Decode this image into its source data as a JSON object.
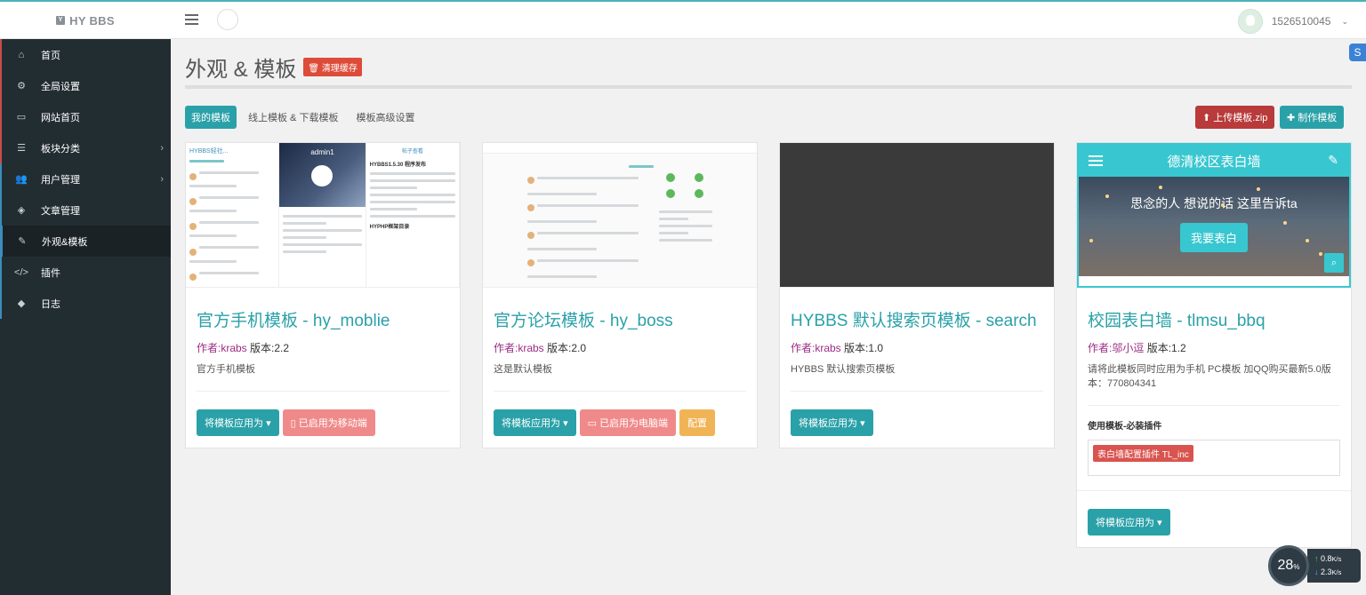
{
  "brand": {
    "name": "HY BBS",
    "icon": "Y"
  },
  "user": {
    "name": "1526510045"
  },
  "sidebar": {
    "items": [
      {
        "label": "首页",
        "icon": "home-icon",
        "glyph": "⌂"
      },
      {
        "label": "全局设置",
        "icon": "gear-icon",
        "glyph": "⚙"
      },
      {
        "label": "网站首页",
        "icon": "monitor-icon",
        "glyph": "▭"
      },
      {
        "label": "板块分类",
        "icon": "list-icon",
        "glyph": "☰"
      },
      {
        "label": "用户管理",
        "icon": "users-icon",
        "glyph": "👥"
      },
      {
        "label": "文章管理",
        "icon": "tags-icon",
        "glyph": "◈"
      },
      {
        "label": "外观&模板",
        "icon": "brush-icon",
        "glyph": "✎"
      },
      {
        "label": "插件",
        "icon": "code-icon",
        "glyph": "</>"
      },
      {
        "label": "日志",
        "icon": "cube-icon",
        "glyph": "◆"
      }
    ]
  },
  "page": {
    "title": "外观 & 模板",
    "clear_cache": "清理缓存"
  },
  "tabs": [
    {
      "label": "我的模板"
    },
    {
      "label": "线上模板 & 下载模板"
    },
    {
      "label": "模板高级设置"
    }
  ],
  "toolbar": {
    "upload": "上传模板.zip",
    "make": "制作模板"
  },
  "cards": [
    {
      "title": "官方手机模板 - hy_moblie",
      "author": "作者:krabs",
      "version": "版本:2.2",
      "desc": "官方手机模板",
      "apply": "将模板应用为",
      "status": "已启用为移动端"
    },
    {
      "title": "官方论坛模板 - hy_boss",
      "author": "作者:krabs",
      "version": "版本:2.0",
      "desc": "这是默认模板",
      "apply": "将模板应用为",
      "status": "已启用为电脑端",
      "config": "配置"
    },
    {
      "title": "HYBBS 默认搜索页模板 - search",
      "author": "作者:krabs",
      "version": "版本:1.0",
      "desc": "HYBBS 默认搜索页模板",
      "apply": "将模板应用为"
    },
    {
      "title": "校园表白墙 - tlmsu_bbq",
      "author": "作者:邬小逗",
      "version": "版本:1.2",
      "desc": "请将此模板同时应用为手机 PC模板 加QQ购买最新5.0版本：770804341",
      "plugins_title": "使用模板-必装插件",
      "plugin_tag": "表白墙配置插件 TL_inc",
      "apply": "将模板应用为",
      "preview": {
        "header": "德清校区表白墙",
        "tagline": "思念的人 想说的话 这里告诉ta",
        "button": "我要表白"
      }
    }
  ],
  "mock": {
    "mobile_header": "HYBBS轻社...",
    "mobile_user": "admin1",
    "mobile_right_title": "帖子查看",
    "mobile_post": "HYBBS1.5.30 程序发布",
    "mobile_bottom": "HYPHP框架目录"
  },
  "speed": {
    "percent": "28",
    "up": "0.8",
    "up_unit": "K/s",
    "down": "2.3",
    "down_unit": "K/s"
  },
  "colors": {
    "accent": "#2aa1a8",
    "sidebar": "#222d32",
    "danger": "#dd4b39",
    "warning": "#f0b456"
  }
}
